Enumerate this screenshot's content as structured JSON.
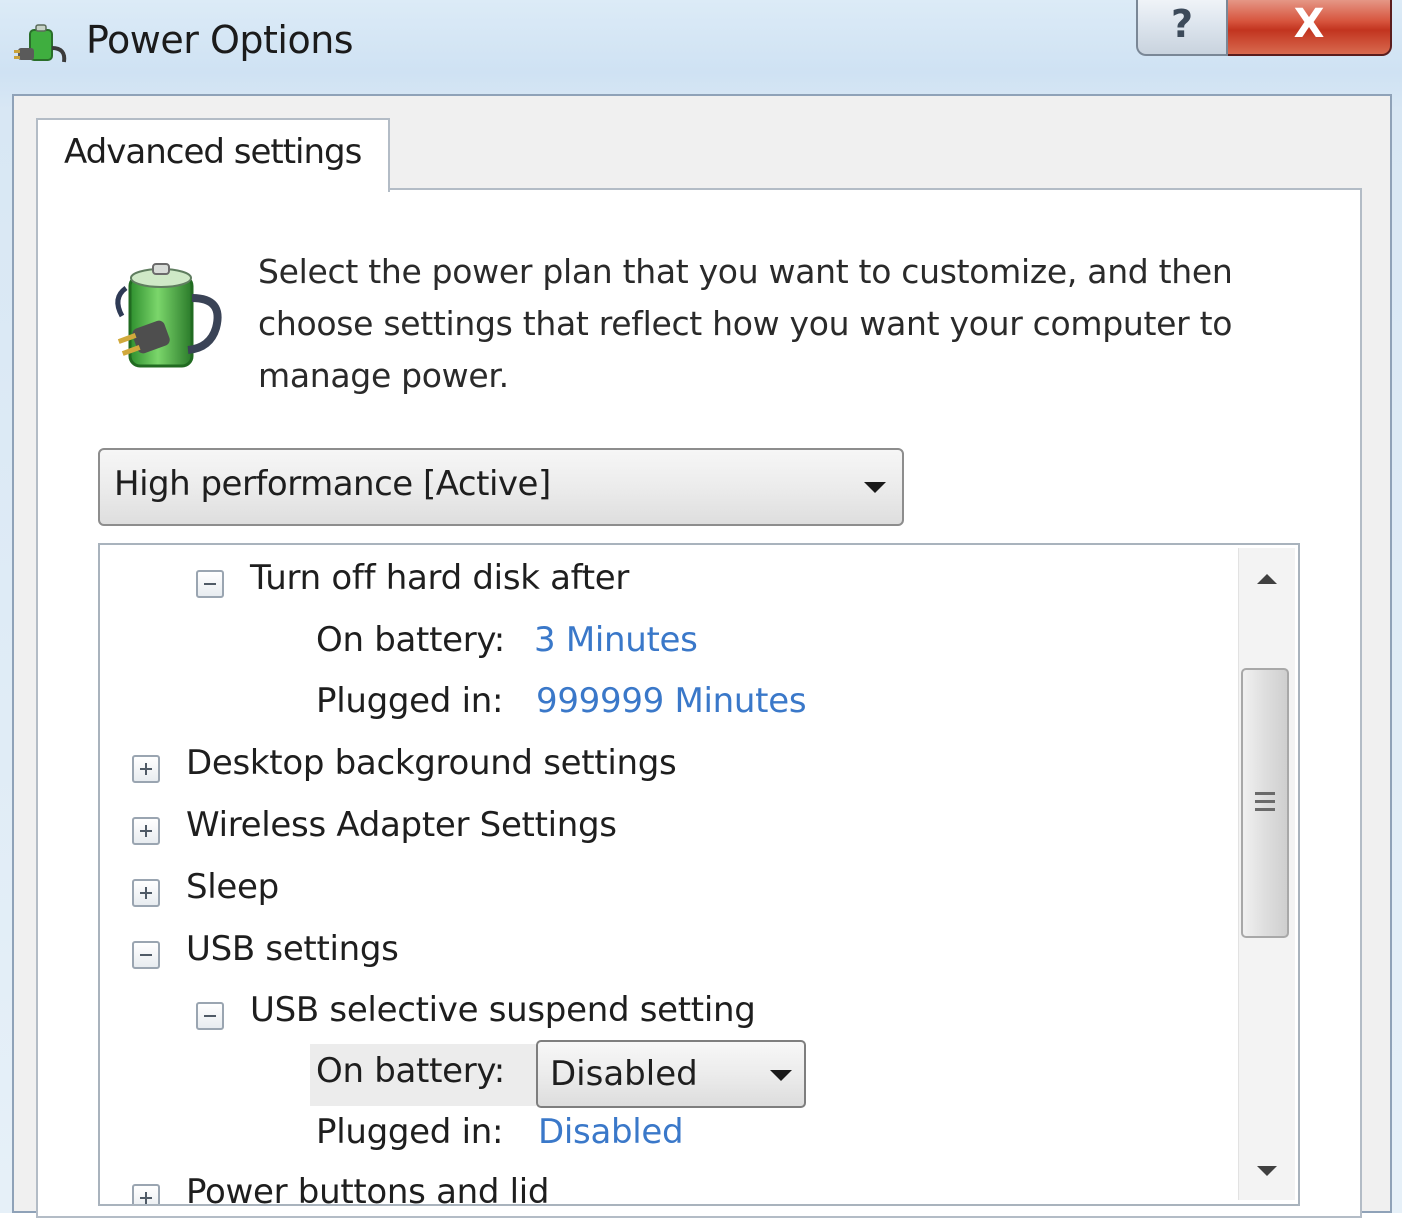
{
  "window": {
    "title": "Power Options",
    "help_symbol": "?",
    "close_symbol": "X"
  },
  "tabs": [
    {
      "label": "Advanced settings"
    }
  ],
  "description": "Select the power plan that you want to customize, and then choose settings that reflect how you want your computer to manage power.",
  "plan_selector": {
    "value": "High performance [Active]"
  },
  "settings_tree": {
    "items": [
      {
        "label": "Turn off hard disk after",
        "state": "expanded"
      },
      {
        "label": "On battery:",
        "value": "3 Minutes"
      },
      {
        "label": "Plugged in:",
        "value": "999999 Minutes"
      },
      {
        "label": "Desktop background settings",
        "state": "collapsed"
      },
      {
        "label": "Wireless Adapter Settings",
        "state": "collapsed"
      },
      {
        "label": "Sleep",
        "state": "collapsed"
      },
      {
        "label": "USB settings",
        "state": "expanded"
      },
      {
        "label": "USB selective suspend setting",
        "state": "expanded"
      },
      {
        "label": "On battery:",
        "value": "Disabled"
      },
      {
        "label": "Plugged in:",
        "value": "Disabled"
      },
      {
        "label": "Power buttons and lid",
        "state": "collapsed"
      }
    ]
  },
  "icons": {
    "app": "power-plug-icon",
    "plan": "battery-plug-icon"
  },
  "colors": {
    "value_link": "#3a78c9",
    "close_button": "#c2341f",
    "battery_green": "#3fae3f"
  }
}
